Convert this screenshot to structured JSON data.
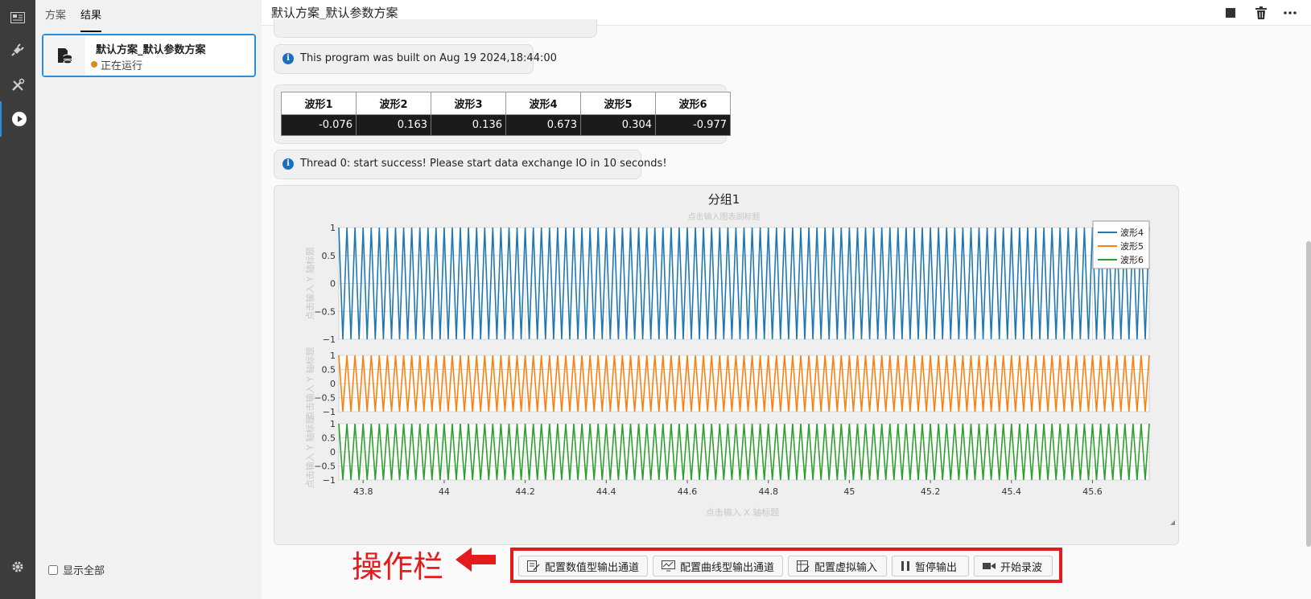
{
  "activity_bar": {
    "items": [
      "dashboard-icon",
      "plug-icon",
      "tools-icon",
      "play-icon"
    ],
    "settings": "gear-icon"
  },
  "sidebar": {
    "tabs": [
      "方案",
      "结果"
    ],
    "active_tab": "结果",
    "card": {
      "title": "默认方案_默认参数方案",
      "status": "正在运行",
      "status_color": "#e08a1e"
    },
    "show_all_label": "显示全部"
  },
  "header": {
    "title": "默认方案_默认参数方案",
    "buttons": [
      "stop-icon",
      "trash-icon",
      "more-icon"
    ]
  },
  "messages": {
    "build": "This program was built on Aug 19 2024,18:44:00",
    "thread": "Thread 0: start success! Please start data exchange IO in 10 seconds!"
  },
  "value_table": {
    "headers": [
      "波形1",
      "波形2",
      "波形3",
      "波形4",
      "波形5",
      "波形6"
    ],
    "values": [
      "-0.076",
      "0.163",
      "0.136",
      "0.673",
      "0.304",
      "-0.977"
    ]
  },
  "chart_data": {
    "type": "line",
    "title": "分组1",
    "subtitle": "点击输入图表副标题",
    "xlabel": "点击输入 X 轴标题",
    "ylabel": "点击输入 Y 轴标题",
    "xlim": [
      43.74,
      45.74
    ],
    "x_ticks": [
      "43.8",
      "44",
      "44.2",
      "44.4",
      "44.6",
      "44.8",
      "45",
      "45.2",
      "45.4",
      "45.6"
    ],
    "y_ticks": [
      "1",
      "0.5",
      "0",
      "−0.5",
      "−1"
    ],
    "legend_position": "top-right",
    "series": [
      {
        "name": "波形4",
        "color": "#1f77b4",
        "ylim": [
          -1,
          1
        ],
        "waveform": "triangle",
        "frequency": 50
      },
      {
        "name": "波形5",
        "color": "#ff7f0e",
        "ylim": [
          -1,
          1
        ],
        "waveform": "triangle",
        "frequency": 50
      },
      {
        "name": "波形6",
        "color": "#2ca02c",
        "ylim": [
          -1,
          1
        ],
        "waveform": "triangle",
        "frequency": 50
      }
    ]
  },
  "annotation": {
    "text": "操作栏",
    "color": "#e41b1b"
  },
  "actions": [
    {
      "label": "配置数值型输出通道",
      "icon": "edit-icon"
    },
    {
      "label": "配置曲线型输出通道",
      "icon": "monitor-chart-icon"
    },
    {
      "label": "配置虚拟输入",
      "icon": "grid-edit-icon"
    },
    {
      "label": "暂停输出",
      "icon": "pause-icon"
    },
    {
      "label": "开始录波",
      "icon": "video-icon"
    }
  ]
}
